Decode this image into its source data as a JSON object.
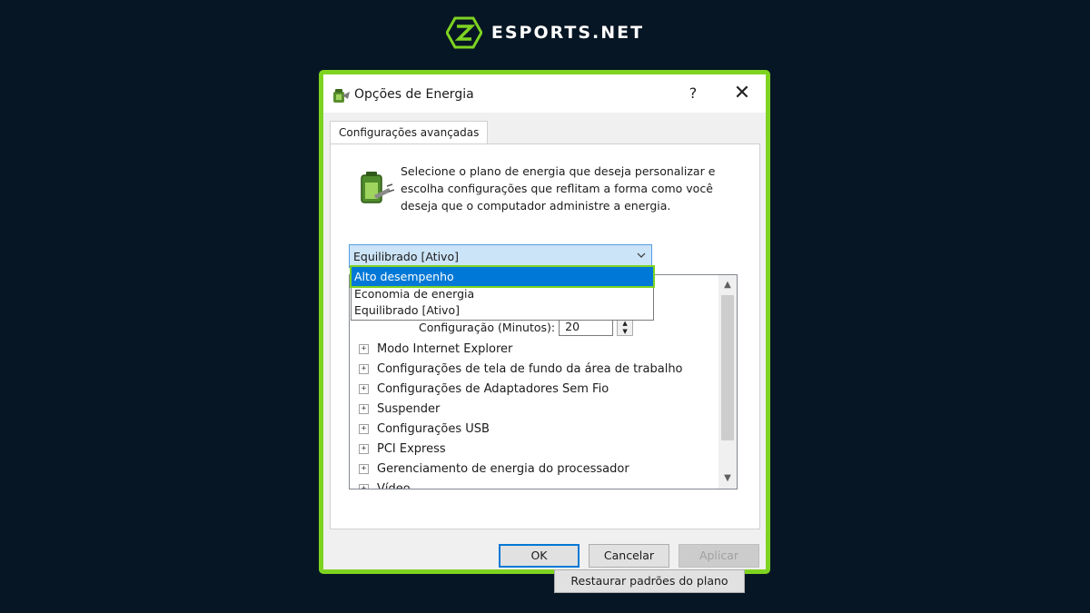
{
  "brand": {
    "name": "ESPORTS.NET",
    "accent": "#7ed321"
  },
  "dialog": {
    "title": "Opções de Energia",
    "help_label": "?",
    "close_label": "✕",
    "tab_label": "Configurações avançadas",
    "description": "Selecione o plano de energia que deseja personalizar e escolha configurações que reflitam a forma como você deseja que o computador administre a energia.",
    "plan_select": {
      "value": "Equilibrado [Ativo]",
      "options": [
        "Alto desempenho",
        "Economia de energia",
        "Equilibrado [Ativo]"
      ],
      "highlighted": "Alto desempenho"
    },
    "config_row": {
      "label": "Configuração (Minutos):",
      "value": "20"
    },
    "tree_items": [
      "Modo Internet Explorer",
      "Configurações de tela de fundo da área de trabalho",
      "Configurações de Adaptadores Sem Fio",
      "Suspender",
      "Configurações USB",
      "PCI Express",
      "Gerenciamento de energia do processador",
      "Vídeo"
    ],
    "restore_label": "Restaurar padrões do plano",
    "ok_label": "OK",
    "cancel_label": "Cancelar",
    "apply_label": "Aplicar"
  }
}
